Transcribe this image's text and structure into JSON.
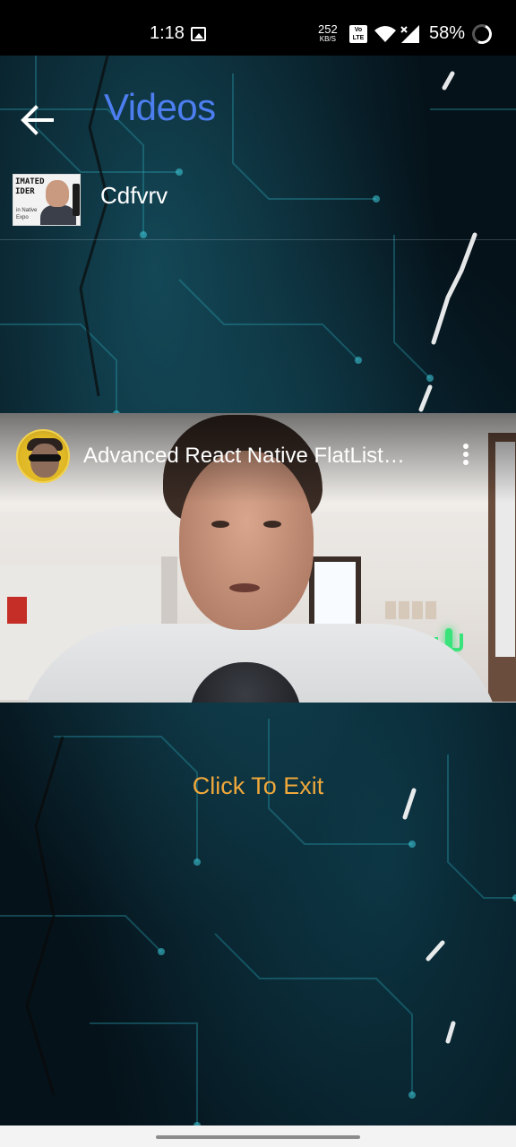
{
  "status_bar": {
    "time": "1:18",
    "net_speed_value": "252",
    "net_speed_unit": "KB/S",
    "volte_label": "Vo LTE",
    "battery": "58%",
    "icons": [
      "gallery-icon",
      "volte-icon",
      "wifi-icon",
      "signal-icon",
      "battery-icon"
    ]
  },
  "header": {
    "title": "Videos",
    "back_icon": "arrow-left-icon",
    "title_color": "#4d7ef0"
  },
  "video_list": [
    {
      "name": "Cdfvrv",
      "thumbnail": {
        "text_lines": [
          "IMATED",
          "IDER"
        ],
        "sub_lines": [
          "in Native",
          "Expo"
        ]
      }
    }
  ],
  "player": {
    "title": "Advanced React Native FlatList…",
    "more_icon": "more-vertical-icon",
    "avatar_icon": "channel-avatar"
  },
  "exit": {
    "label": "Click To Exit",
    "color": "#efa83b"
  }
}
